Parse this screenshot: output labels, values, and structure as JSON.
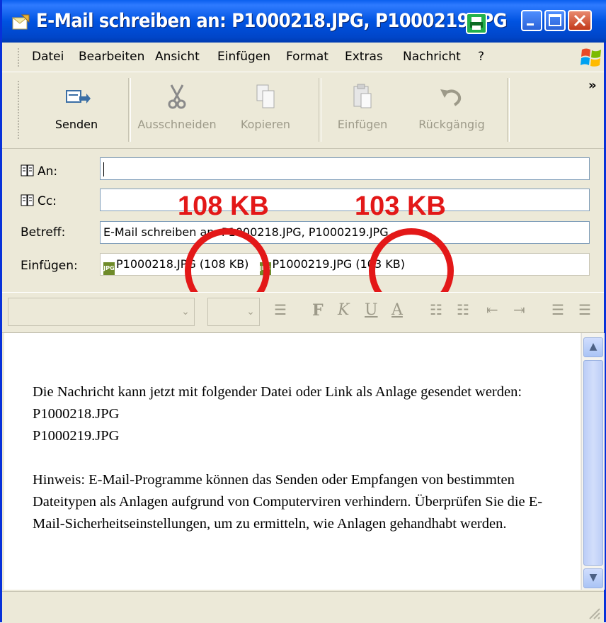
{
  "window": {
    "title": "E-Mail schreiben an: P1000218.JPG, P1000219.JPG"
  },
  "menubar": {
    "items": [
      "Datei",
      "Bearbeiten",
      "Ansicht",
      "Einfügen",
      "Format",
      "Extras",
      "Nachricht",
      "?"
    ]
  },
  "toolbar": {
    "send": "Senden",
    "cut": "Ausschneiden",
    "copy": "Kopieren",
    "paste": "Einfügen",
    "undo": "Rückgängig",
    "more": "»"
  },
  "header": {
    "to_label": "An:",
    "to_value": "",
    "cc_label": "Cc:",
    "cc_value": "",
    "subject_label": "Betreff:",
    "subject_value": "E-Mail schreiben an: P1000218.JPG, P1000219.JPG",
    "attach_label": "Einfügen:",
    "attachments": [
      {
        "name": "P1000218.JPG (108 KB)"
      },
      {
        "name": "P1000219.JPG (103 KB)"
      }
    ]
  },
  "annotations": {
    "size1": "108 KB",
    "size2": "103 KB",
    "color": "#E31818"
  },
  "format_toolbar": {
    "bold": "F",
    "italic": "K",
    "underline": "U",
    "font_color": "A"
  },
  "body": {
    "lines": [
      "Die Nachricht kann jetzt mit folgender Datei oder Link als Anlage gesendet werden:",
      "P1000218.JPG",
      "P1000219.JPG",
      "",
      "Hinweis: E-Mail-Programme können das Senden oder Empfangen von bestimmten Dateitypen als Anlagen aufgrund von Computerviren verhindern. Überprüfen Sie die E-Mail-Sicherheitseinstellungen, um zu ermitteln, wie Anlagen gehandhabt werden."
    ]
  }
}
